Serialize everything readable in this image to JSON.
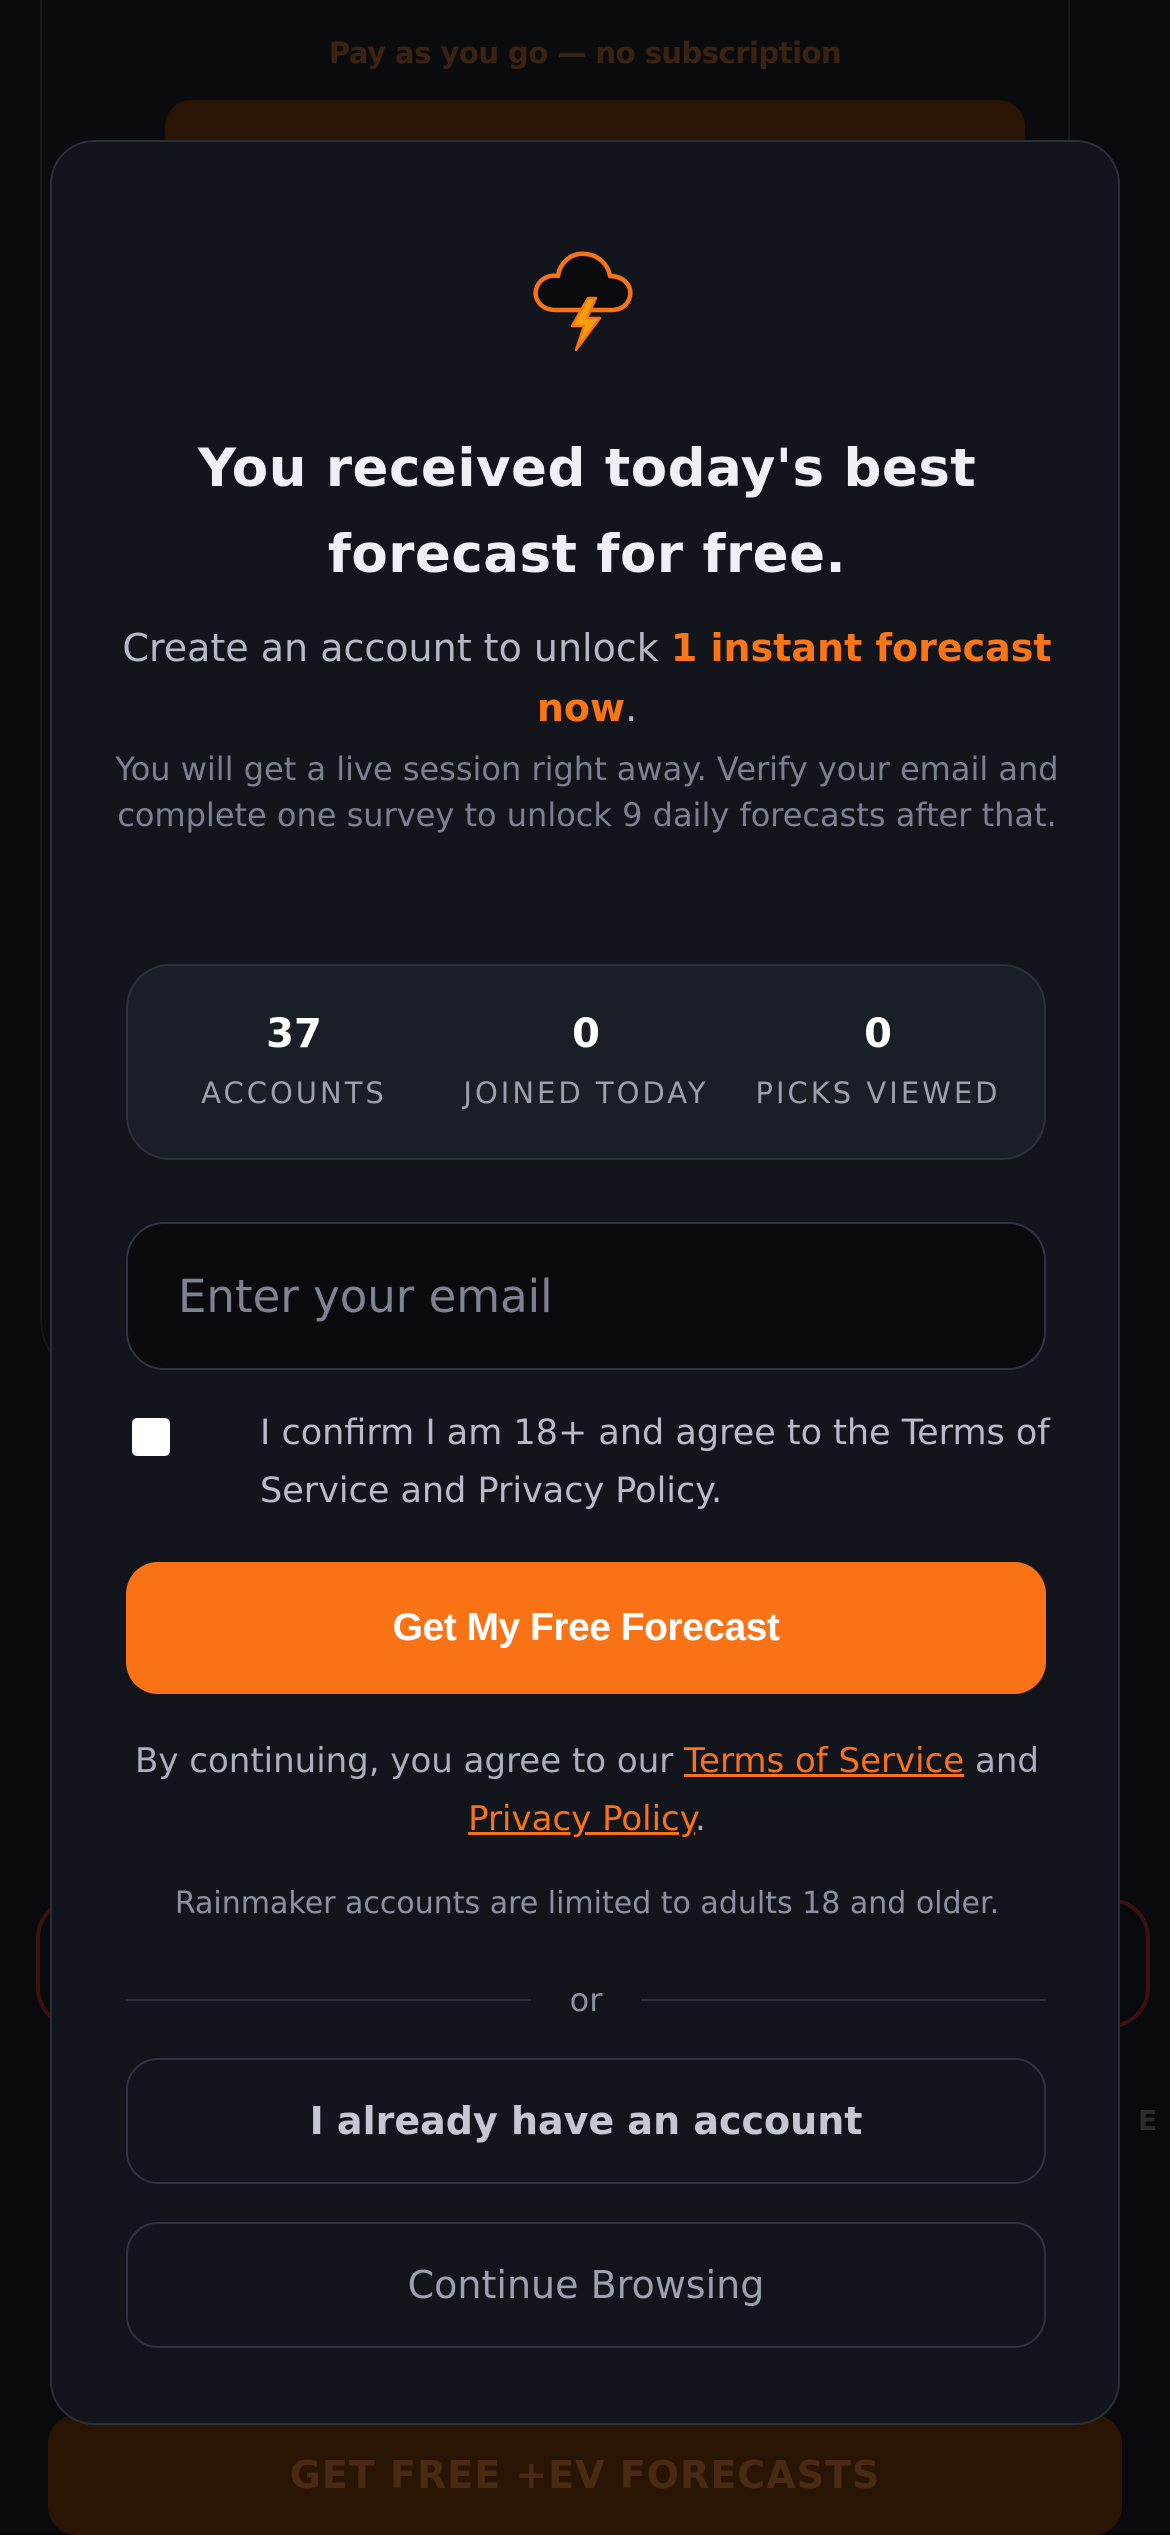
{
  "background": {
    "subline": "Pay as you go — no subscription",
    "bottom_cta": "GET FREE +EV FORECASTS",
    "side_letter": "E"
  },
  "modal": {
    "logo_icon": "storm-cloud-lightning-icon",
    "title": "You received today's best forecast for free.",
    "subtitle_prefix": "Create an account to unlock ",
    "subtitle_highlight": "1 instant forecast now",
    "subtitle_suffix": ".",
    "note": "You will get a live session right away. Verify your email and complete one survey to unlock 9 daily forecasts after that.",
    "stats": [
      {
        "value": "37",
        "label": "ACCOUNTS"
      },
      {
        "value": "0",
        "label": "JOINED TODAY"
      },
      {
        "value": "0",
        "label": "PICKS VIEWED"
      }
    ],
    "email": {
      "placeholder": "Enter your email",
      "value": ""
    },
    "consent": {
      "checked": false,
      "text": "I confirm I am 18+ and agree to the Terms of Service and Privacy Policy."
    },
    "primary_button": "Get My Free Forecast",
    "legal": {
      "prefix": "By continuing, you agree to our ",
      "terms_link": "Terms of Service",
      "middle": " and ",
      "privacy_link": "Privacy Policy",
      "suffix": "."
    },
    "age_note": "Rainmaker accounts are limited to adults 18 and older.",
    "divider": "or",
    "login_button": "I already have an account",
    "browse_button": "Continue Browsing"
  },
  "colors": {
    "accent": "#f97316",
    "modal_bg": "#12151c",
    "page_bg": "#090a0d"
  }
}
